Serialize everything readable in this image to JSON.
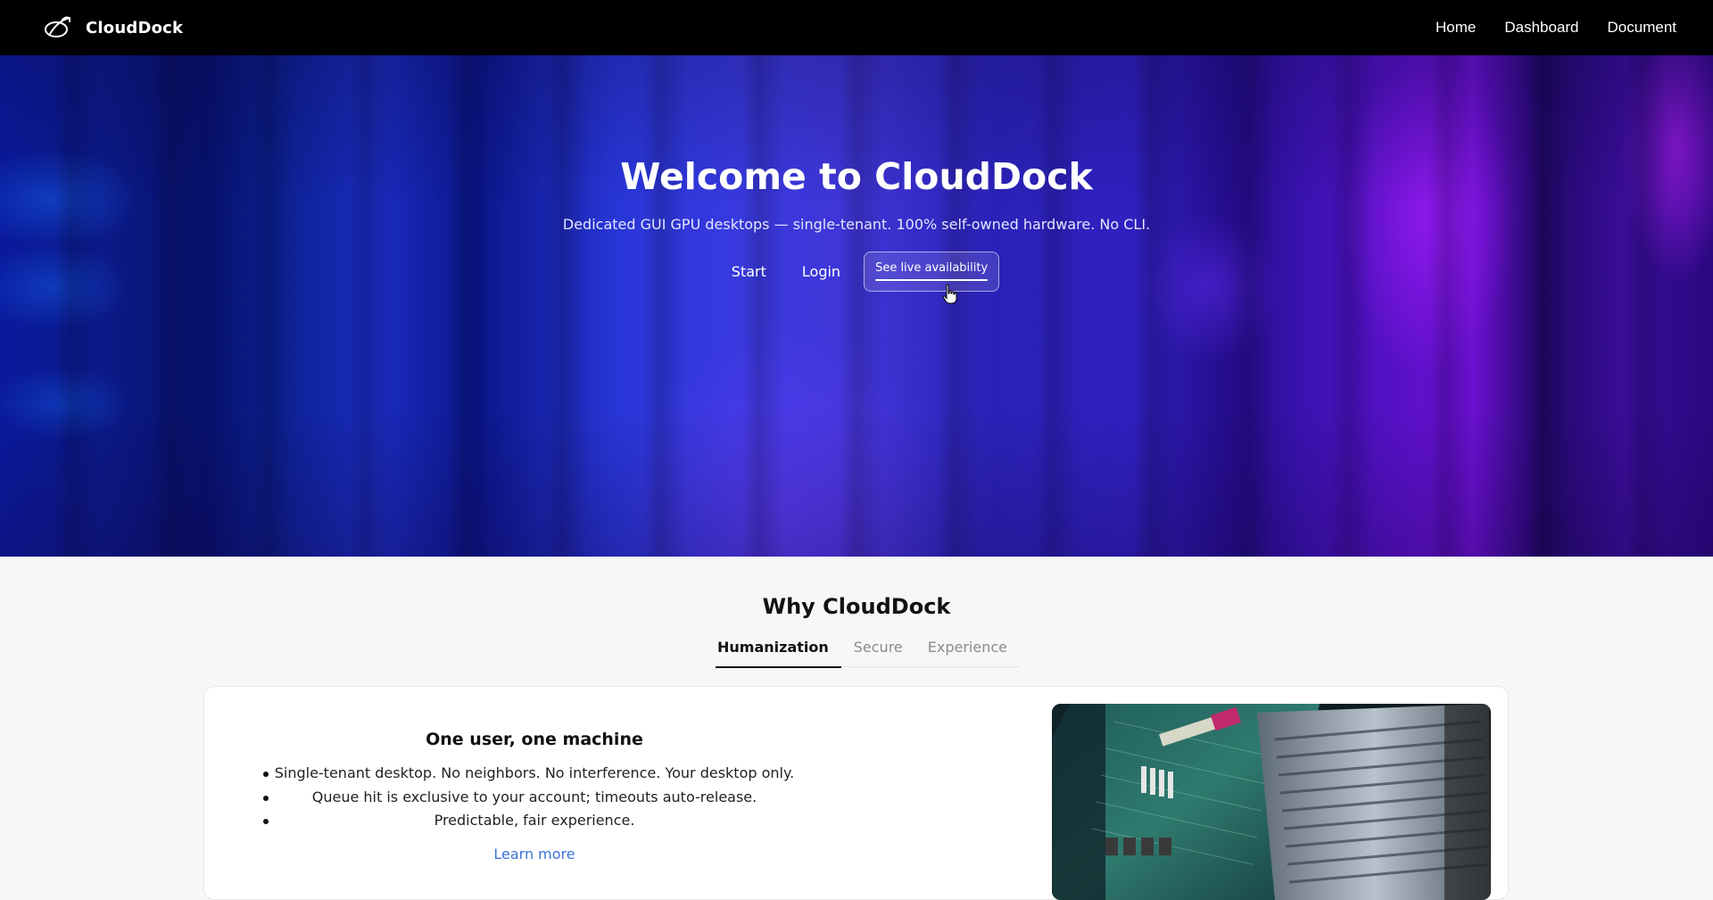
{
  "navbar": {
    "brand_name": "CloudDock",
    "links": [
      "Home",
      "Dashboard",
      "Document"
    ]
  },
  "hero": {
    "title": "Welcome to CloudDock",
    "subtitle": "Dedicated GUI GPU desktops — single-tenant. 100% self-owned hardware. No CLI.",
    "actions": {
      "start": "Start",
      "login": "Login",
      "availability": "See live availability"
    }
  },
  "why": {
    "title": "Why CloudDock",
    "tabs": [
      {
        "label": "Humanization",
        "active": true
      },
      {
        "label": "Secure",
        "active": false
      },
      {
        "label": "Experience",
        "active": false
      }
    ],
    "card": {
      "heading": "One user, one machine",
      "bullets": [
        "Single-tenant desktop. No neighbors. No interference. Your desktop only.",
        "Queue hit is exclusive to your account; timeouts auto-release.",
        "Predictable, fair experience."
      ],
      "link": "Learn more",
      "image_icon": "server-motherboard-photo"
    }
  },
  "colors": {
    "nav_bg": "#000000",
    "link_blue": "#3b73d6",
    "hero_violet": "#6a10d0",
    "hero_blue": "#2836d8"
  }
}
